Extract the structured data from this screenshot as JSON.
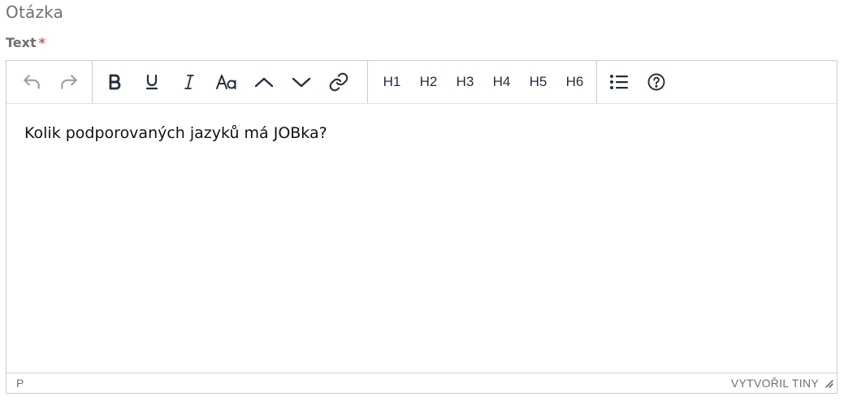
{
  "section": {
    "title": "Otázka"
  },
  "field": {
    "label": "Text",
    "required_mark": "*"
  },
  "toolbar": {
    "history": [
      {
        "name": "undo-icon",
        "disabled": true
      },
      {
        "name": "redo-icon",
        "disabled": true
      }
    ],
    "format": [
      "bold-icon",
      "underline-icon",
      "italic-icon",
      "font-size-icon",
      "superscript-icon",
      "subscript-icon",
      "link-icon"
    ],
    "headings": [
      "H1",
      "H2",
      "H3",
      "H4",
      "H5",
      "H6"
    ],
    "extra": [
      "bullet-list-icon",
      "help-icon"
    ]
  },
  "editor": {
    "content": "Kolik podporovaných jazyků má JOBka?"
  },
  "statusbar": {
    "path": "P",
    "brand": "VYTVOŘIL TINY"
  },
  "colors": {
    "icon": "#222f3e",
    "icon_disabled": "#9aa0a6",
    "border": "#cccccc",
    "required": "#d9534f"
  }
}
